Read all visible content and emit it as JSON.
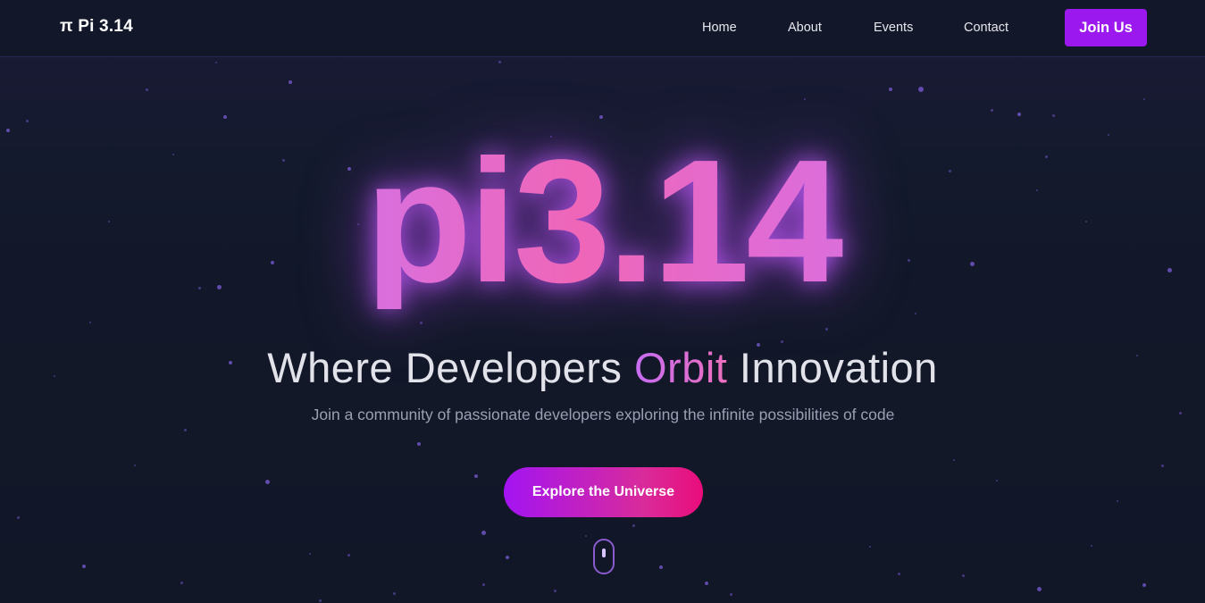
{
  "navbar": {
    "brand": "π Pi 3.14",
    "links": [
      {
        "label": "Home"
      },
      {
        "label": "About"
      },
      {
        "label": "Events"
      },
      {
        "label": "Contact"
      }
    ],
    "cta_label": "Join Us"
  },
  "hero": {
    "title": "pi3.14",
    "tagline_before": "Where Developers ",
    "tagline_accent": "Orbit",
    "tagline_after": " Innovation",
    "subtitle": "Join a community of passionate developers exploring the infinite possibilities of code",
    "cta_label": "Explore the Universe"
  },
  "colors": {
    "background": "#121829",
    "accent_purple": "#9b19ee",
    "accent_pink": "#e90d7b",
    "glow": "#c45cff"
  },
  "icons": {
    "scroll_indicator": "mouse-scroll-icon"
  }
}
